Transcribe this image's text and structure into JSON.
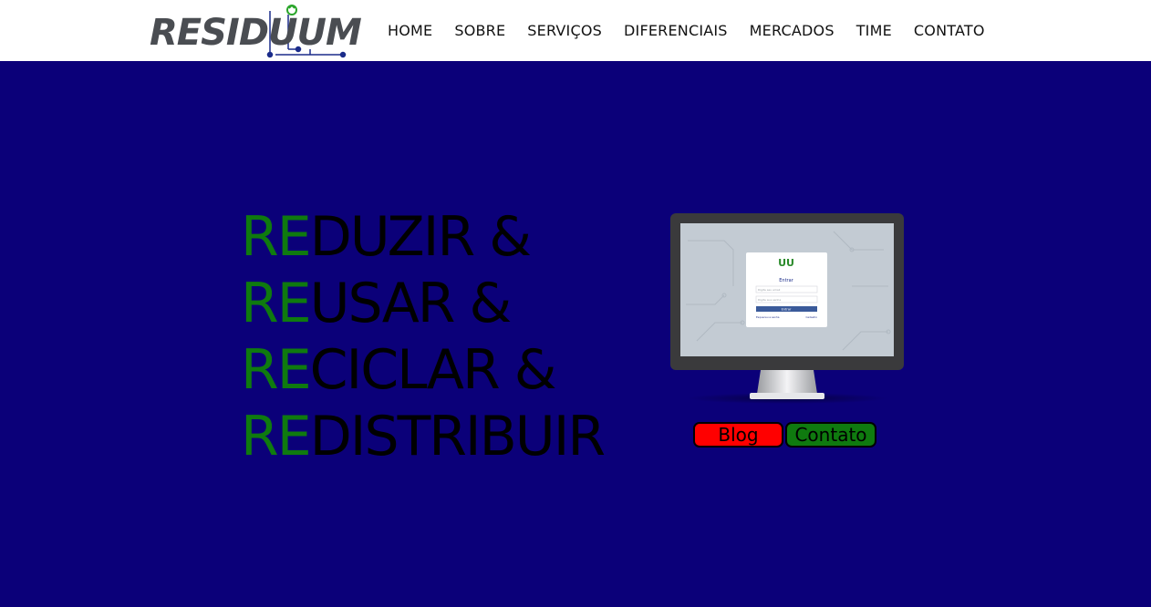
{
  "header": {
    "logo_text": "RESIDUUM",
    "nav": [
      {
        "label": "HOME"
      },
      {
        "label": "SOBRE"
      },
      {
        "label": "SERVIÇOS"
      },
      {
        "label": "DIFERENCIAIS"
      },
      {
        "label": "MERCADOS"
      },
      {
        "label": "TIME"
      },
      {
        "label": "CONTATO"
      }
    ]
  },
  "hero": {
    "lines": [
      {
        "prefix": "RE",
        "rest": "DUZIR &"
      },
      {
        "prefix": "RE",
        "rest": "USAR &"
      },
      {
        "prefix": "RE",
        "rest": "CICLAR &"
      },
      {
        "prefix": "RE",
        "rest": "DISTRIBUIR"
      }
    ],
    "monitor_login": {
      "logo": "UU",
      "title": "Entrar",
      "field1_placeholder": "Digite seu email",
      "field2_placeholder": "Digite sua senha",
      "button_label": "Entrar",
      "link_left": "Esqueceu a senha",
      "link_right": "Cadastro"
    }
  },
  "buttons": {
    "blog": "Blog",
    "contato": "Contato"
  },
  "colors": {
    "background": "#0b0079",
    "accent_green": "#0f7a0f",
    "blog_red": "#ff0000",
    "logo_gray": "#4a4d52",
    "logo_blue": "#1b2c8a"
  }
}
